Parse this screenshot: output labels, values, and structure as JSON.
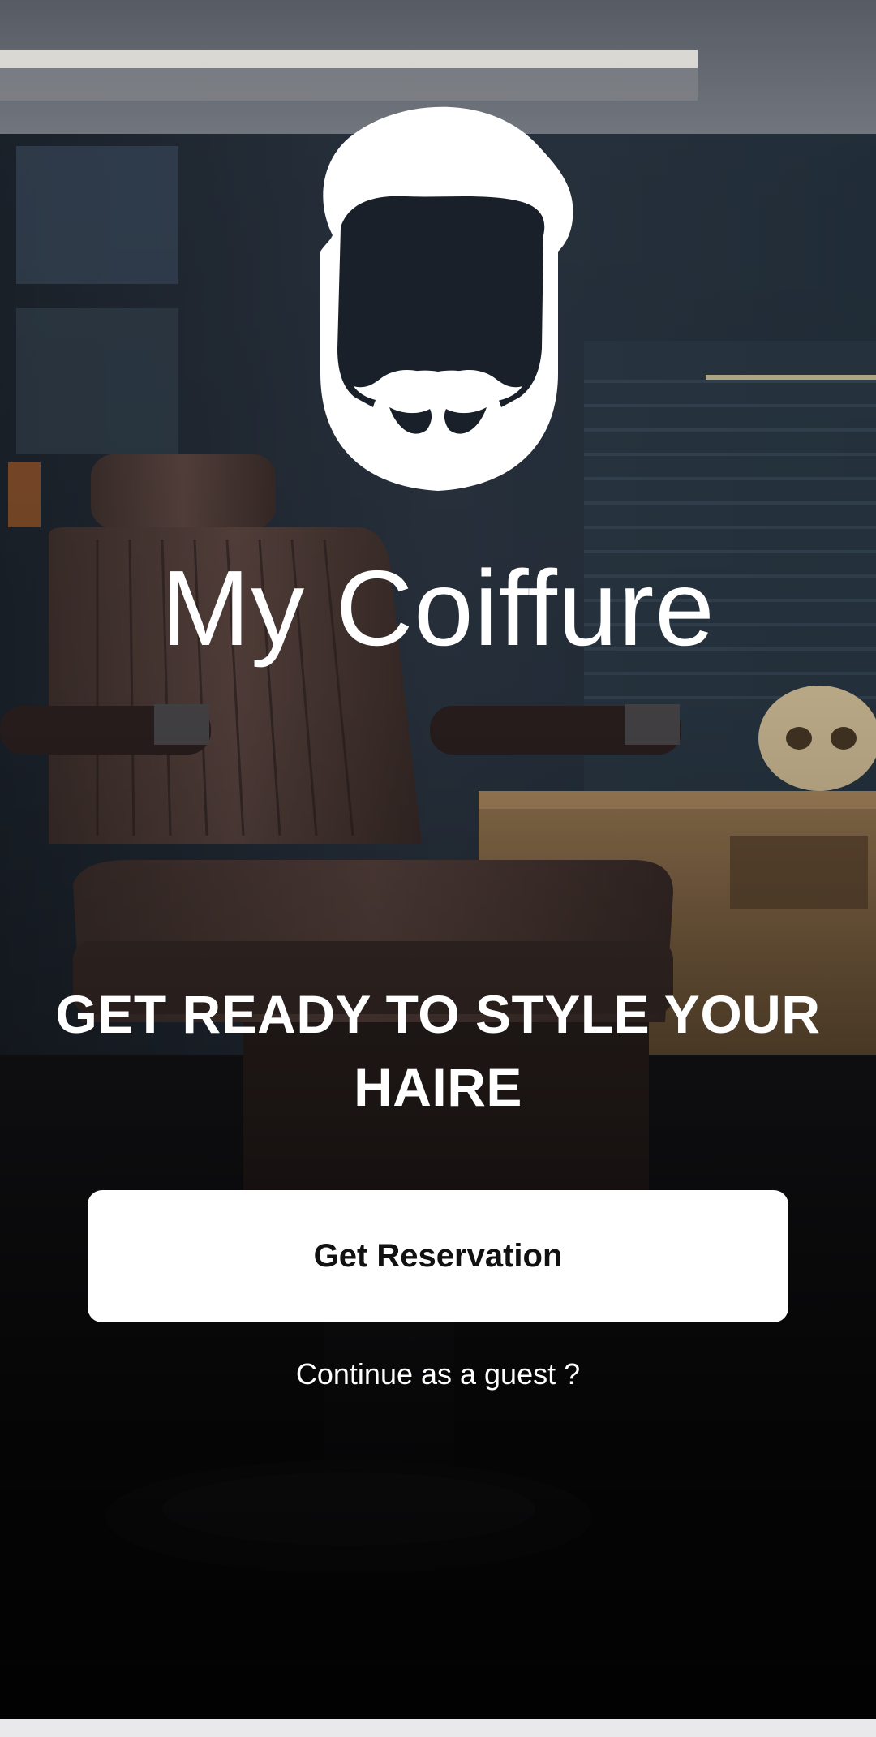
{
  "app": {
    "title": "My Coiffure",
    "logo_icon": "bearded-man-logo-icon"
  },
  "hero": {
    "tagline": "GET READY TO STYLE YOUR HAIRE"
  },
  "actions": {
    "primary_label": "Get Reservation",
    "guest_label": "Continue as a guest ?"
  },
  "background": {
    "description_icon": "barber-chair-photo",
    "colors": {
      "wall": "#2a3340",
      "leather": "#4a3a36",
      "wood": "#8a6a48",
      "floor": "#0d0d10"
    }
  },
  "colors": {
    "button_bg": "#ffffff",
    "button_text": "#111111",
    "text_primary": "#ffffff"
  }
}
